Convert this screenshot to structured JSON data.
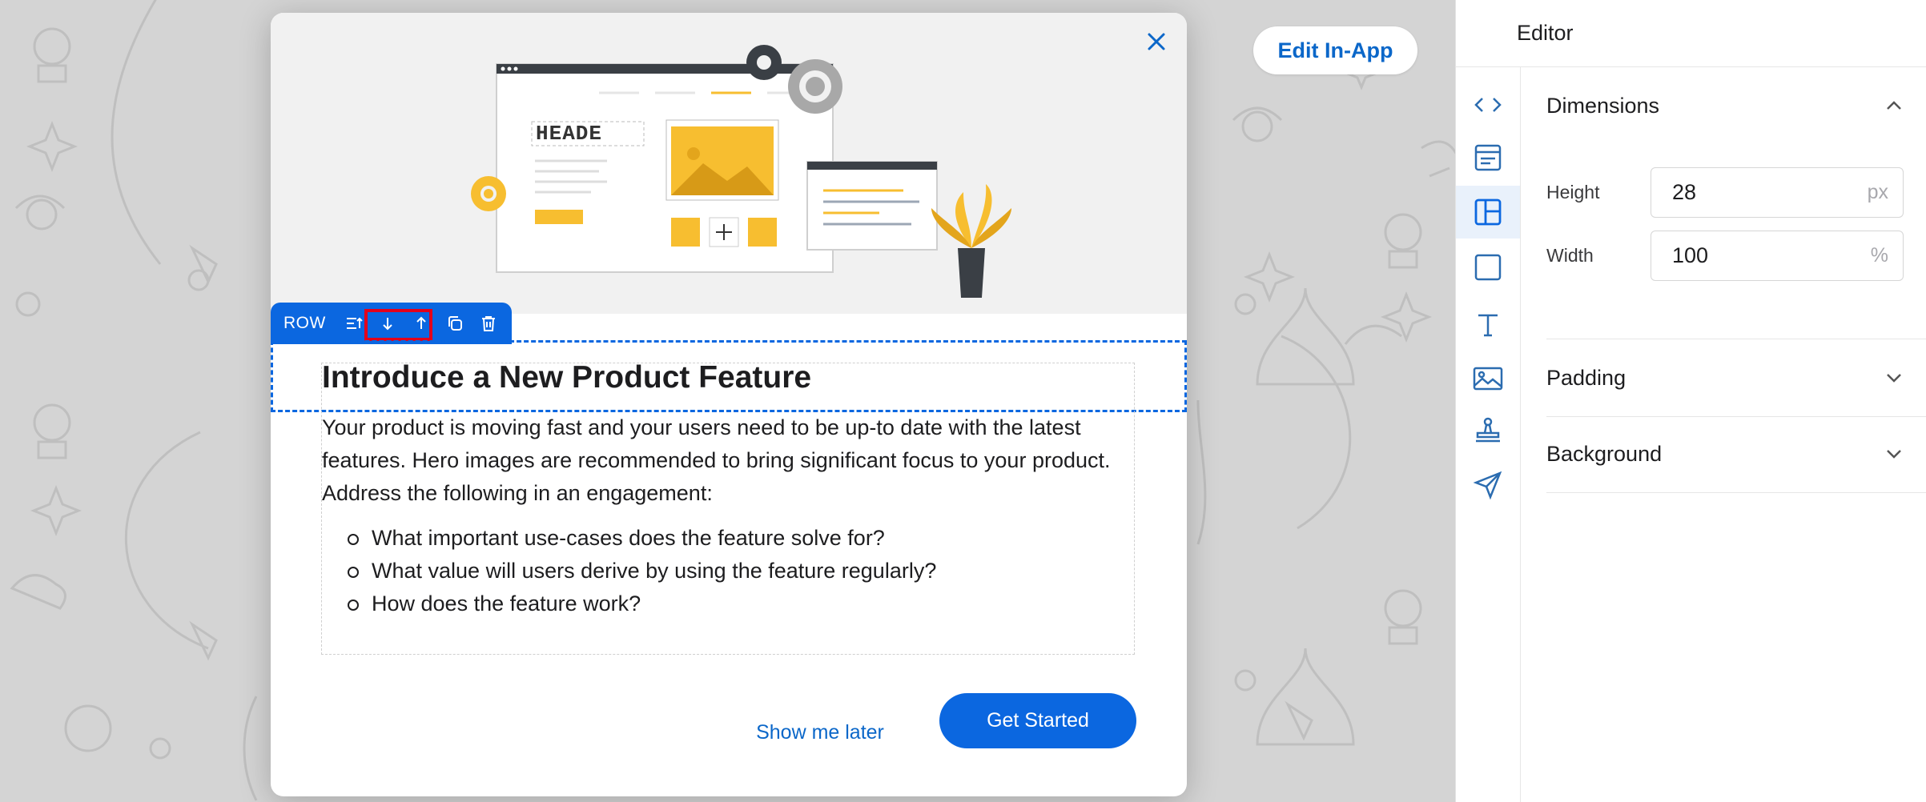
{
  "canvas": {
    "edit_inapp_label": "Edit In-App"
  },
  "modal": {
    "hero_header_text": "HEADE",
    "toolbar": {
      "label": "ROW"
    },
    "title": "Introduce a New Product Feature",
    "body": "Your product is moving fast and your users need to be up-to date with the latest features. Hero images are recommended to bring significant focus to your product. Address the following in an engagement:",
    "bullets": [
      "What important use-cases does the feature solve for?",
      "What value will users derive by using the feature regularly?",
      "How does the feature work?"
    ],
    "secondary_button": "Show me later",
    "primary_button": "Get Started"
  },
  "editor": {
    "title": "Editor",
    "rail_icons": [
      "code-icon",
      "layout-header-icon",
      "layout-row-icon",
      "container-icon",
      "text-icon",
      "image-icon",
      "stamp-icon",
      "send-icon"
    ],
    "sections": {
      "dimensions": "Dimensions",
      "padding": "Padding",
      "background": "Background"
    },
    "fields": {
      "height": {
        "label": "Height",
        "value": "28",
        "unit": "px"
      },
      "width": {
        "label": "Width",
        "value": "100",
        "unit": "%"
      }
    }
  },
  "colors": {
    "accent": "#0b67e0",
    "link": "#0b67c9",
    "highlight": "#e3001b",
    "gold": "#f7be30"
  }
}
